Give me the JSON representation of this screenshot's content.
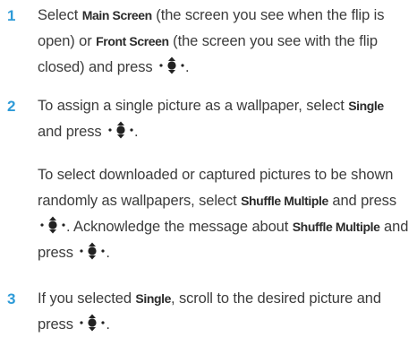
{
  "steps": [
    {
      "number": "1",
      "paragraphs": [
        {
          "parts": [
            {
              "text": "Select "
            },
            {
              "text": "Main Screen",
              "kw": true
            },
            {
              "text": " (the screen you see when the flip is open) or "
            },
            {
              "text": "Front Screen",
              "kw": true
            },
            {
              "text": " (the screen you see with the flip closed) and press "
            },
            {
              "icon": "nav-key-icon"
            },
            {
              "text": "."
            }
          ]
        }
      ]
    },
    {
      "number": "2",
      "paragraphs": [
        {
          "parts": [
            {
              "text": "To assign a single picture as a wallpaper, select "
            },
            {
              "text": "Single",
              "kw": true
            },
            {
              "text": " and press "
            },
            {
              "icon": "nav-key-icon"
            },
            {
              "text": "."
            }
          ]
        },
        {
          "parts": [
            {
              "text": "To select downloaded or captured pictures to be shown randomly as wallpapers, select "
            },
            {
              "text": "Shuffle Multiple",
              "kw": true
            },
            {
              "text": " and press "
            },
            {
              "icon": "nav-key-icon"
            },
            {
              "text": ". Acknowledge the message about "
            },
            {
              "text": "Shuffle Multiple",
              "kw": true
            },
            {
              "text": " and press "
            },
            {
              "icon": "nav-key-icon"
            },
            {
              "text": "."
            }
          ]
        }
      ]
    },
    {
      "number": "3",
      "paragraphs": [
        {
          "parts": [
            {
              "text": "If you selected "
            },
            {
              "text": "Single",
              "kw": true
            },
            {
              "text": ", scroll to the desired picture and press "
            },
            {
              "icon": "nav-key-icon"
            },
            {
              "text": "."
            }
          ]
        }
      ]
    }
  ],
  "colors": {
    "step_number": "#2e9bd8",
    "body_text": "#3c3c3c",
    "keyword": "#2b2b2b"
  }
}
